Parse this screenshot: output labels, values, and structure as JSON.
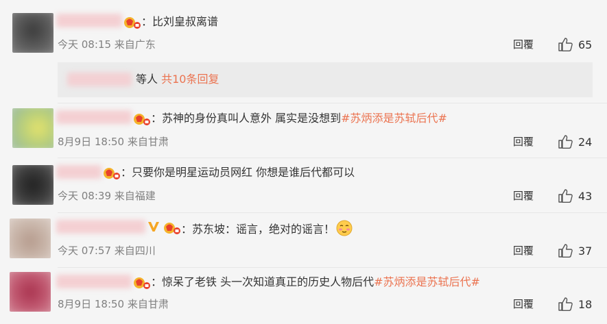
{
  "comments": [
    {
      "text_prefix": "：比刘皇叔离谱",
      "tag": "",
      "text_suffix": "",
      "time": "今天 08:15",
      "source": "来自广东",
      "reply_label": "回覆",
      "likes": "65"
    },
    {
      "text_prefix": "：苏神的身份真叫人意外 属实是没想到",
      "tag": "#苏炳添是苏轼后代#",
      "text_suffix": "",
      "time": "8月9日 18:50",
      "source": "来自甘肃",
      "reply_label": "回覆",
      "likes": "24"
    },
    {
      "text_prefix": "：只要你是明星运动员网红 你想是谁后代都可以",
      "tag": "",
      "text_suffix": "",
      "time": "今天 08:39",
      "source": "来自福建",
      "reply_label": "回覆",
      "likes": "43"
    },
    {
      "text_prefix": "：苏东坡：谣言，绝对的谣言！",
      "tag": "",
      "text_suffix": "",
      "time": "今天 07:57",
      "source": "来自四川",
      "reply_label": "回覆",
      "likes": "37"
    },
    {
      "text_prefix": "：惊呆了老铁 头一次知道真正的历史人物后代",
      "tag": "#苏炳添是苏轼后代#",
      "text_suffix": "",
      "time": "8月9日 18:50",
      "source": "来自甘肃",
      "reply_label": "回覆",
      "likes": "18"
    }
  ],
  "thread": {
    "label": "等人",
    "more": "共10条回复"
  },
  "icons": {
    "badge": "fan-badge-icon",
    "vip": "verified-v-icon",
    "like": "thumbs-up-icon",
    "emoji": "blushing-face-emoji"
  },
  "colors": {
    "tag": "#eb7350",
    "meta": "#808080",
    "background": "#f5f5f5",
    "vip": "#f5a623"
  }
}
